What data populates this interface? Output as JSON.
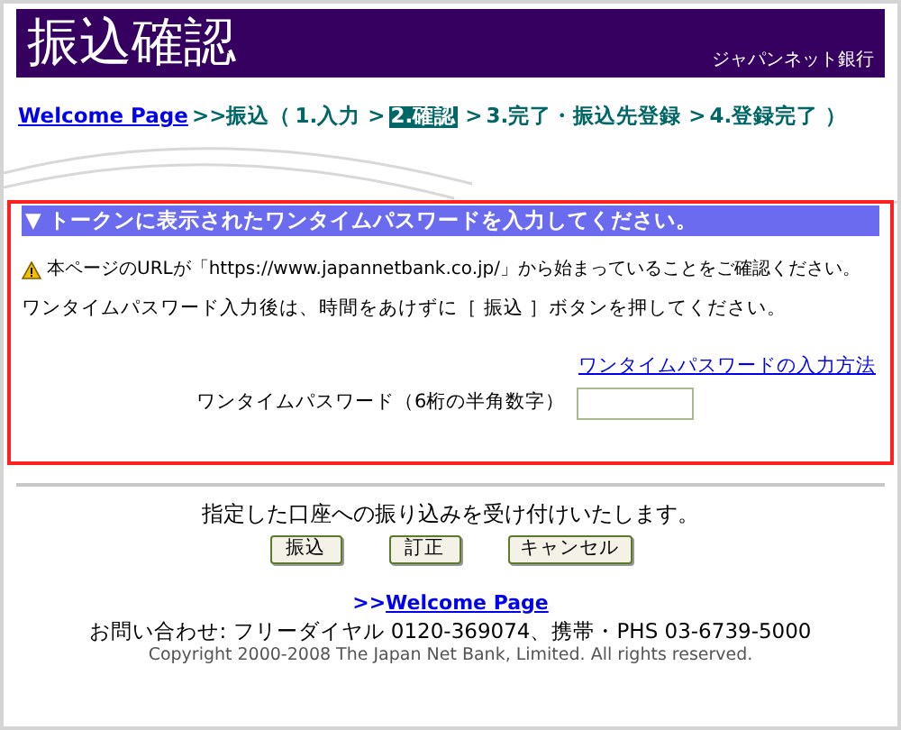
{
  "header": {
    "title": "振込確認",
    "brand": "ジャパンネット銀行"
  },
  "breadcrumb": [
    {
      "kind": "link",
      "text": "Welcome Page"
    },
    {
      "kind": "text",
      "text": ">>振込（"
    },
    {
      "kind": "step",
      "text": "1.入力",
      "selected": false
    },
    {
      "kind": "text",
      "text": ">"
    },
    {
      "kind": "step",
      "text": "2.確認",
      "selected": true
    },
    {
      "kind": "text",
      "text": ">"
    },
    {
      "kind": "step",
      "text": "3.完了・振込先登録",
      "selected": false
    },
    {
      "kind": "text",
      "text": ">"
    },
    {
      "kind": "step",
      "text": "4.登録完了",
      "selected": false
    },
    {
      "kind": "text",
      "text": "）"
    }
  ],
  "token_panel": {
    "heading": "▼ トークンに表示されたワンタイムパスワードを入力してください。",
    "notice": "本ページのURLが「https://www.japannetbank.co.jp/」から始まっていることをご確認ください。",
    "instruction": "ワンタイムパスワード入力後は、時間をあけずに［ 振込 ］ボタンを押してください。",
    "help_link": "ワンタイムパスワードの入力方法",
    "field_label": "ワンタイムパスワード（6桁の半角数字）"
  },
  "confirm_message": "指定した口座への振り込みを受け付けいたします。",
  "buttons": [
    "振込",
    "訂正",
    "キャンセル"
  ],
  "footer": {
    "link_prefix": ">>",
    "link": "Welcome Page",
    "contact": "お問い合わせ: フリーダイヤル 0120-369074、携帯・PHS 03-6739-5000",
    "copyright": "Copyright 2000-2008 The Japan Net Bank, Limited. All rights reserved."
  }
}
